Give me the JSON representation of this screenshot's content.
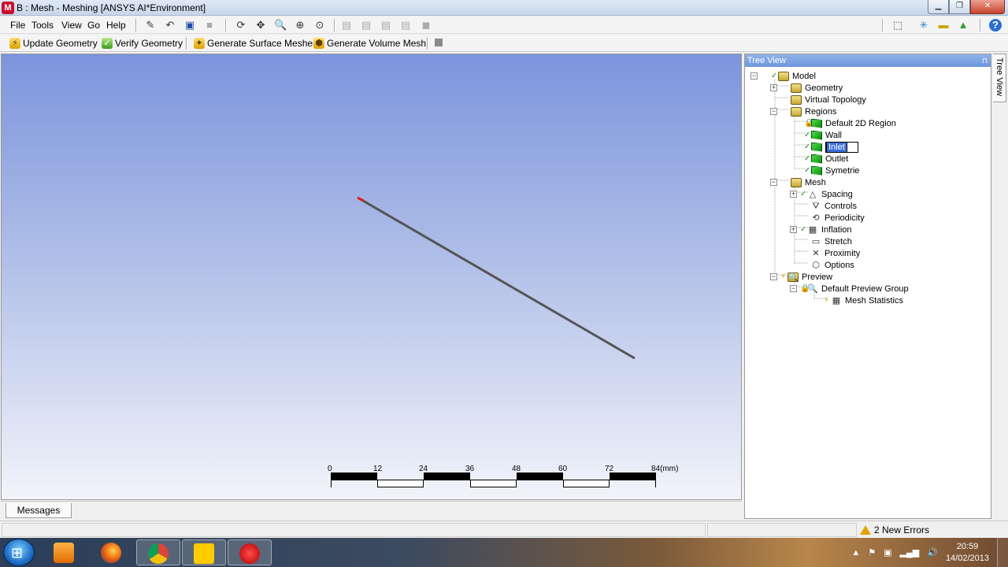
{
  "window": {
    "title": "B : Mesh - Meshing [ANSYS AI*Environment]",
    "app_icon_letter": "M"
  },
  "menu": {
    "items": [
      "File",
      "Tools",
      "View",
      "Go",
      "Help"
    ]
  },
  "toolbar2": {
    "update_geometry": "Update Geometry",
    "verify_geometry": "Verify Geometry",
    "generate_surface_meshes": "Generate Surface Meshes",
    "generate_volume_mesh": "Generate Volume Mesh"
  },
  "viewport": {
    "scale": {
      "ticks": [
        "0",
        "12",
        "24",
        "36",
        "48",
        "60",
        "72",
        "84(mm)"
      ]
    }
  },
  "messages_tab": "Messages",
  "tree": {
    "header": "Tree View",
    "side_tab": "Tree View",
    "nodes": {
      "model": "Model",
      "geometry": "Geometry",
      "virtual_topology": "Virtual Topology",
      "regions": "Regions",
      "default_2d_region": "Default 2D Region",
      "wall": "Wall",
      "inlet": "Inlet",
      "outlet": "Outlet",
      "symetrie": "Symetrie",
      "mesh": "Mesh",
      "spacing": "Spacing",
      "controls": "Controls",
      "periodicity": "Periodicity",
      "inflation": "Inflation",
      "stretch": "Stretch",
      "proximity": "Proximity",
      "options": "Options",
      "preview": "Preview",
      "default_preview_group": "Default Preview Group",
      "mesh_statistics": "Mesh Statistics"
    }
  },
  "status": {
    "errors": "2 New Errors"
  },
  "taskbar": {
    "time": "20:59",
    "date": "14/02/2013"
  },
  "colors": {
    "accent_red": "#c8102e",
    "tree_header": "#7ea3e0",
    "selection": "#3a6fd8"
  }
}
